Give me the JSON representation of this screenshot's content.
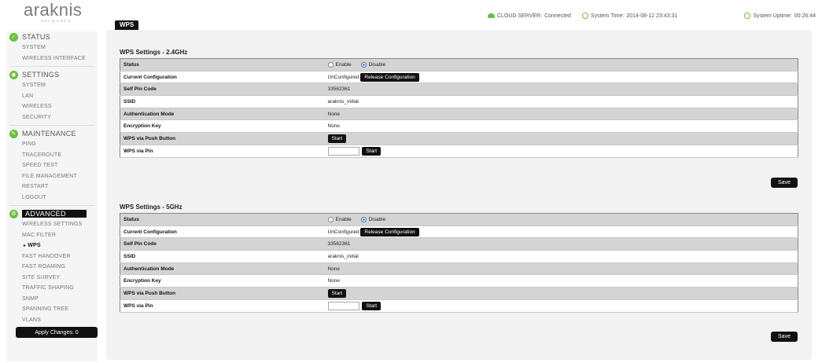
{
  "logo": {
    "name": "araknis",
    "sub": "NETWORKS"
  },
  "topbar": {
    "cloud_label": "CLOUD SERVER:",
    "cloud_value": "Connected",
    "time_label": "System Time:",
    "time_value": "2014-08-12 23:43:31",
    "uptime_label": "System Uptime:",
    "uptime_value": "00:26:44"
  },
  "page_tab": "WPS",
  "sidebar": {
    "sections": [
      {
        "title": "STATUS",
        "items": [
          "SYSTEM",
          "WIRELESS INTERFACE"
        ]
      },
      {
        "title": "SETTINGS",
        "items": [
          "SYSTEM",
          "LAN",
          "WIRELESS",
          "SECURITY"
        ]
      },
      {
        "title": "MAINTENANCE",
        "items": [
          "PING",
          "TRACEROUTE",
          "SPEED TEST",
          "FILE MANAGEMENT",
          "RESTART",
          "LOGOUT"
        ]
      },
      {
        "title": "ADVANCED",
        "items": [
          "WIRELESS SETTINGS",
          "MAC FILTER",
          "WPS",
          "FAST HANDOVER",
          "FAST ROAMING",
          "SITE SURVEY",
          "TRAFFIC SHAPING",
          "SNMP",
          "SPANNING TREE",
          "VLANS"
        ]
      }
    ],
    "apply_label": "Apply Changes: 0"
  },
  "wps": {
    "sections": [
      {
        "title": "WPS Settings - 2.4GHz",
        "status_label": "Status",
        "enable_label": "Enable",
        "disable_label": "Disable",
        "current_config_label": "Current Configuration",
        "current_config_value": "UnConfigured",
        "release_label": "Release Configuration",
        "self_pin_label": "Self Pin Code",
        "self_pin_value": "33562361",
        "ssid_label": "SSID",
        "ssid_value": "araknis_initial",
        "auth_label": "Authentication Mode",
        "auth_value": "None",
        "enc_label": "Encryption Key",
        "enc_value": "None",
        "push_label": "WPS via Push Button",
        "push_start": "Start",
        "pin_label": "WPS via Pin",
        "pin_start": "Start",
        "save_label": "Save"
      },
      {
        "title": "WPS Settings - 5GHz",
        "status_label": "Status",
        "enable_label": "Enable",
        "disable_label": "Disable",
        "current_config_label": "Current Configuration",
        "current_config_value": "UnConfigured",
        "release_label": "Release Configuration",
        "self_pin_label": "Self Pin Code",
        "self_pin_value": "33562361",
        "ssid_label": "SSID",
        "ssid_value": "araknis_initial",
        "auth_label": "Authentication Mode",
        "auth_value": "None",
        "enc_label": "Encryption Key",
        "enc_value": "None",
        "push_label": "WPS via Push Button",
        "push_start": "Start",
        "pin_label": "WPS via Pin",
        "pin_start": "Start",
        "save_label": "Save"
      }
    ]
  },
  "colors": {
    "accent": "#6cbf3f",
    "dark": "#111111",
    "row_shade": "#d4d4d4"
  }
}
